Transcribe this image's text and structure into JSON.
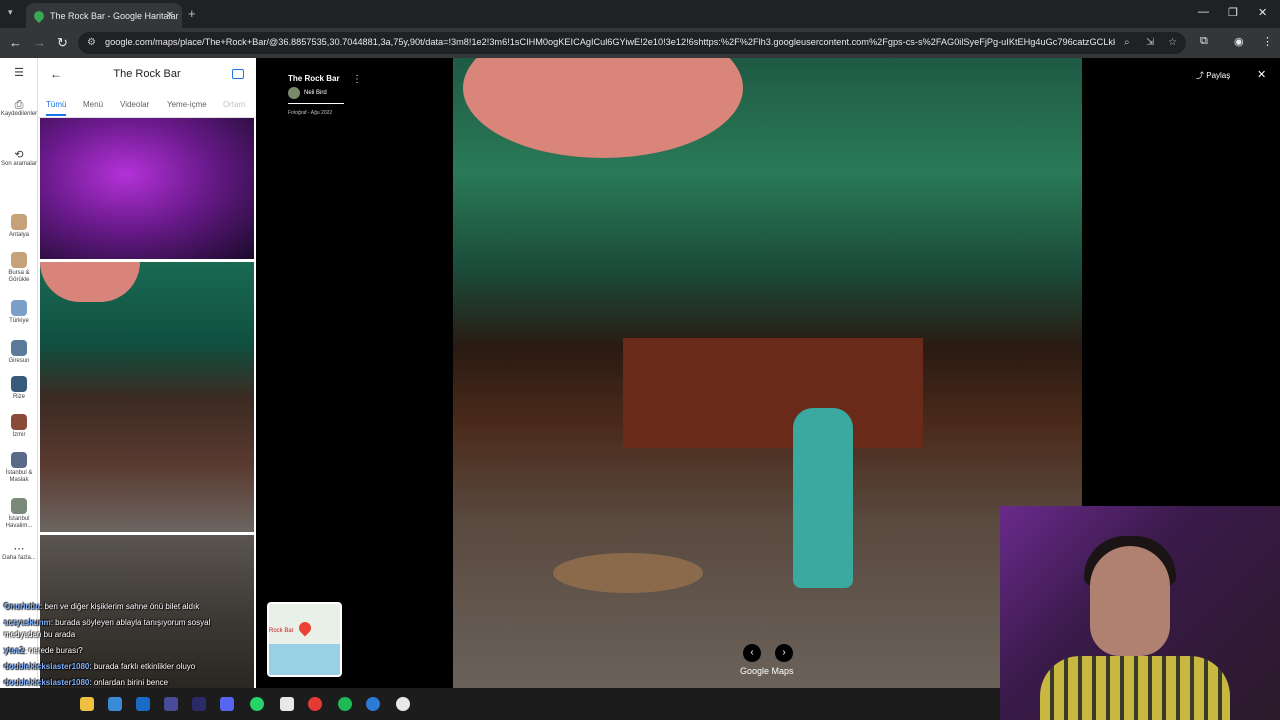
{
  "browser": {
    "tab_title": "The Rock Bar - Google Haritalar",
    "url": "google.com/maps/place/The+Rock+Bar/@36.8857535,30.7044881,3a,75y,90t/data=!3m8!1e2!3m6!1sCIHM0ogKEICAgICul6GYiwE!2e10!3e12!6shttps:%2F%2Flh3.googleusercontent.com%2Fgps-cs-s%2FAG0ilSyeFjPg-uIKtEHg4uGc796catzGCLkkF..."
  },
  "rail": {
    "items": [
      {
        "label": "Kaydedilenler",
        "icon": "bookmark-icon"
      },
      {
        "label": "Son aramalar",
        "icon": "history-icon"
      },
      {
        "label": "Antalya",
        "icon": "place-thumb"
      },
      {
        "label": "Bursa & Görükle",
        "icon": "place-thumb"
      },
      {
        "label": "Türkiye",
        "icon": "place-thumb"
      },
      {
        "label": "Giresun",
        "icon": "place-thumb"
      },
      {
        "label": "Rize",
        "icon": "place-thumb"
      },
      {
        "label": "İzmir",
        "icon": "place-thumb"
      },
      {
        "label": "İstanbul & Maslak",
        "icon": "place-thumb"
      },
      {
        "label": "İstanbul Havalim...",
        "icon": "place-thumb"
      },
      {
        "label": "Daha fazla...",
        "icon": "more-icon"
      }
    ]
  },
  "panel": {
    "title": "The Rock Bar",
    "tabs": [
      "Tümü",
      "Menü",
      "Videolar",
      "Yeme-içme",
      "Ortam"
    ],
    "active_tab": "Tümü"
  },
  "viewer": {
    "author_place": "The Rock Bar",
    "author_name": "Neil Bird",
    "photo_date": "Fotoğraf - Ağu 2022",
    "share_label": "Paylaş",
    "logo": "Google Maps",
    "minimap_label": "Rock Bar"
  },
  "chat": [
    {
      "user": "Onurlutlu",
      "text": "ben ve diğer kişiklerim sahne önü bilet aldık"
    },
    {
      "user": "acryaskunm",
      "text": "burada söyleyen ablayla tanışıyorum sosyal"
    },
    {
      "user": "",
      "text": "medyadan bu arada"
    },
    {
      "user": "ytsa2",
      "text": "nerede burası?"
    },
    {
      "user": "doublekickslaster1080",
      "text": "burada farklı etkinlikler oluyo"
    },
    {
      "user": "doublekickslaster1080",
      "text": "onlardan birini bence"
    }
  ],
  "colors": {
    "accent": "#1a73e8",
    "chrome_dark": "#202124",
    "chrome_toolbar": "#35363a"
  }
}
